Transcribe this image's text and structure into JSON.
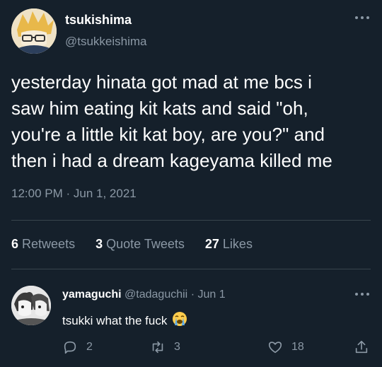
{
  "tweet": {
    "author_name": "tsukishima",
    "author_handle": "@tsukkeishima",
    "text": "yesterday hinata got mad at me bcs i\nsaw him eating kit kats and said \"oh,\nyou're a little kit kat boy, are you?\" and\nthen i had a dream kageyama killed me",
    "timestamp": "12:00 PM · Jun 1, 2021",
    "stats": {
      "retweets_count": "6",
      "retweets_label": "Retweets",
      "quotes_count": "3",
      "quotes_label": "Quote Tweets",
      "likes_count": "27",
      "likes_label": "Likes"
    }
  },
  "reply": {
    "author_name": "yamaguchi",
    "author_handle": "@tadaguchii",
    "date": "· Jun 1",
    "text": "tsukki what the fuck",
    "emoji": "loudly-crying-face",
    "reply_count": "2",
    "retweet_count": "3",
    "like_count": "18"
  },
  "colors": {
    "background": "#15202b",
    "text_primary": "#ffffff",
    "text_secondary": "#8b98a5",
    "divider": "#38444d"
  },
  "icons": [
    "more-icon",
    "reply-icon",
    "retweet-icon",
    "like-icon",
    "share-icon"
  ]
}
